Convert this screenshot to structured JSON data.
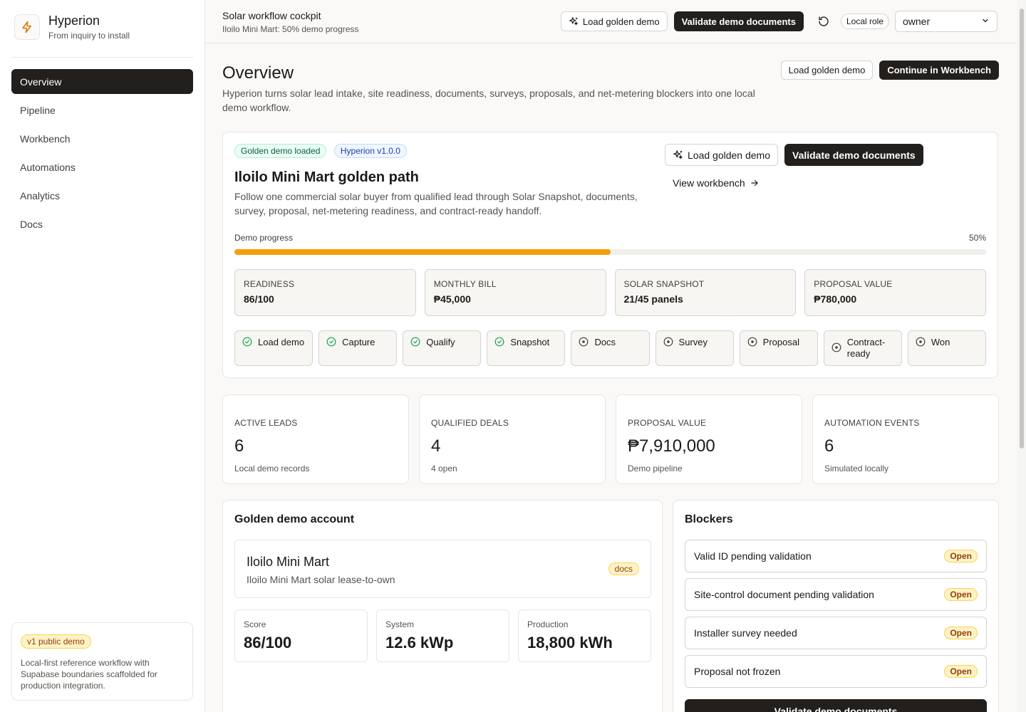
{
  "brand": {
    "name": "Hyperion",
    "tagline": "From inquiry to install"
  },
  "nav": {
    "items": [
      {
        "label": "Overview",
        "active": true
      },
      {
        "label": "Pipeline"
      },
      {
        "label": "Workbench"
      },
      {
        "label": "Automations"
      },
      {
        "label": "Analytics"
      },
      {
        "label": "Docs"
      }
    ]
  },
  "promo": {
    "badge": "v1 public demo",
    "text": "Local-first reference workflow with Supabase boundaries scaffolded for production integration."
  },
  "header": {
    "title": "Solar workflow cockpit",
    "subtitle": "Iloilo Mini Mart: 50% demo progress",
    "load_label": "Load golden demo",
    "validate_label": "Validate demo documents",
    "role_label": "Local role",
    "role_value": "owner"
  },
  "page": {
    "title": "Overview",
    "description": "Hyperion turns solar lead intake, site readiness, documents, surveys, proposals, and net-metering blockers into one local demo workflow.",
    "load_label": "Load golden demo",
    "continue_label": "Continue in Workbench"
  },
  "demo": {
    "pill_loaded": "Golden demo loaded",
    "pill_version": "Hyperion v1.0.0",
    "title": "Iloilo Mini Mart golden path",
    "description": "Follow one commercial solar buyer from qualified lead through Solar Snapshot, documents, survey, proposal, net-metering readiness, and contract-ready handoff.",
    "load_label": "Load golden demo",
    "validate_label": "Validate demo documents",
    "view_label": "View workbench",
    "progress_label": "Demo progress",
    "progress_text": "50%",
    "progress_value": 0.5,
    "stats": [
      {
        "label": "READINESS",
        "value": "86/100"
      },
      {
        "label": "MONTHLY BILL",
        "value": "₱45,000"
      },
      {
        "label": "SOLAR SNAPSHOT",
        "value": "21/45 panels"
      },
      {
        "label": "PROPOSAL VALUE",
        "value": "₱780,000"
      }
    ],
    "steps": [
      {
        "label": "Load demo",
        "done": true
      },
      {
        "label": "Capture",
        "done": true
      },
      {
        "label": "Qualify",
        "done": true
      },
      {
        "label": "Snapshot",
        "done": true
      },
      {
        "label": "Docs",
        "done": false
      },
      {
        "label": "Survey",
        "done": false
      },
      {
        "label": "Proposal",
        "done": false
      },
      {
        "label": "Contract-ready",
        "done": false
      },
      {
        "label": "Won",
        "done": false
      }
    ]
  },
  "metrics": [
    {
      "label": "ACTIVE LEADS",
      "value": "6",
      "sub": "Local demo records"
    },
    {
      "label": "QUALIFIED DEALS",
      "value": "4",
      "sub": "4 open"
    },
    {
      "label": "PROPOSAL VALUE",
      "value": "₱7,910,000",
      "sub": "Demo pipeline"
    },
    {
      "label": "AUTOMATION EVENTS",
      "value": "6",
      "sub": "Simulated locally"
    }
  ],
  "account": {
    "section_title": "Golden demo account",
    "name": "Iloilo Mini Mart",
    "subtitle": "Iloilo Mini Mart solar lease-to-own",
    "badge": "docs",
    "stats": [
      {
        "label": "Score",
        "value": "86/100"
      },
      {
        "label": "System",
        "value": "12.6 kWp"
      },
      {
        "label": "Production",
        "value": "18,800 kWh"
      }
    ]
  },
  "blockers": {
    "section_title": "Blockers",
    "items": [
      {
        "label": "Valid ID pending validation",
        "status": "Open"
      },
      {
        "label": "Site-control document pending validation",
        "status": "Open"
      },
      {
        "label": "Installer survey needed",
        "status": "Open"
      },
      {
        "label": "Proposal not frozen",
        "status": "Open"
      }
    ],
    "button_label": "Validate demo documents"
  },
  "colors": {
    "accent": "#f59e0b",
    "dark": "#231f1c",
    "success": "#16a34a",
    "warning_bg": "#fef3c7"
  }
}
